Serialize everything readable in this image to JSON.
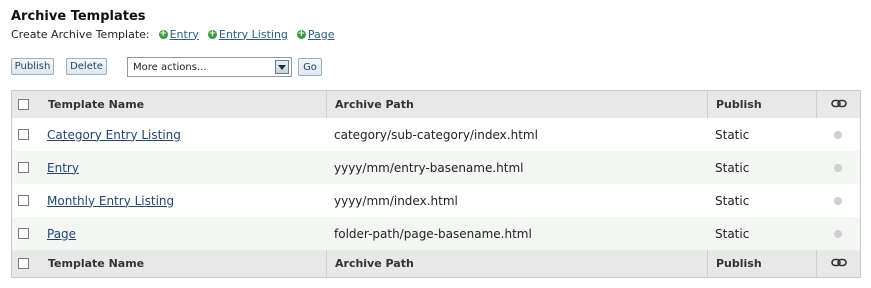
{
  "page": {
    "title": "Archive Templates",
    "create_label": "Create Archive Template:",
    "create_links": [
      "Entry",
      "Entry Listing",
      "Page"
    ]
  },
  "toolbar": {
    "publish_label": "Publish",
    "delete_label": "Delete",
    "actions_select_value": "More actions...",
    "go_label": "Go"
  },
  "table": {
    "columns": [
      "Template Name",
      "Archive Path",
      "Publish"
    ],
    "rows": [
      {
        "name": "Category Entry Listing",
        "path": "category/sub-category/index.html",
        "publish": "Static"
      },
      {
        "name": "Entry",
        "path": "yyyy/mm/entry-basename.html",
        "publish": "Static"
      },
      {
        "name": "Monthly Entry Listing",
        "path": "yyyy/mm/index.html",
        "publish": "Static"
      },
      {
        "name": "Page",
        "path": "folder-path/page-basename.html",
        "publish": "Static"
      }
    ]
  },
  "icons": {
    "link_column": "link-icon",
    "row_status": "status-dot-icon",
    "create": "plus-circle-icon",
    "select_arrow": "dropdown-arrow-icon"
  },
  "colors": {
    "link": "#22466f",
    "create_plus": "#3d9a3d",
    "header_bg": "#e8e8e8"
  }
}
